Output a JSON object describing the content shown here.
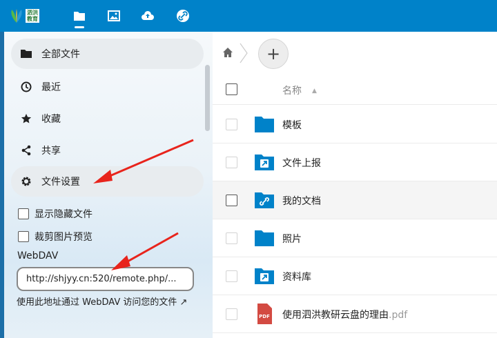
{
  "topbar": {
    "logo_text": "泗洪\n教育",
    "apps": [
      {
        "icon": "folder-icon",
        "active": true
      },
      {
        "icon": "image-icon",
        "active": false
      },
      {
        "icon": "cloud-upload-icon",
        "active": false
      },
      {
        "icon": "link-circle-icon",
        "active": false
      }
    ],
    "bg_color": "#0082c9"
  },
  "sidebar": {
    "items": [
      {
        "label": "全部文件",
        "icon": "folder-icon"
      },
      {
        "label": "最近",
        "icon": "clock-icon"
      },
      {
        "label": "收藏",
        "icon": "star-icon"
      },
      {
        "label": "共享",
        "icon": "share-icon"
      },
      {
        "label": "文件设置",
        "icon": "gear-icon"
      }
    ],
    "settings": {
      "show_hidden_label": "显示隐藏文件",
      "crop_preview_label": "裁剪图片预览",
      "webdav_label": "WebDAV",
      "webdav_url": "http://shjyy.cn:520/remote.php/...",
      "webdav_help": "使用此地址通过 WebDAV 访问您的文件 ↗"
    }
  },
  "main": {
    "add_button": "+",
    "header": {
      "name_label": "名称",
      "sort_indicator": "▲"
    },
    "files": [
      {
        "name": "模板",
        "ext": "",
        "icon": "folder-icon"
      },
      {
        "name": "文件上报",
        "ext": "",
        "icon": "shared-folder-icon"
      },
      {
        "name": "我的文档",
        "ext": "",
        "icon": "linked-folder-icon"
      },
      {
        "name": "照片",
        "ext": "",
        "icon": "folder-icon"
      },
      {
        "name": "资料库",
        "ext": "",
        "icon": "shared-folder-icon"
      },
      {
        "name": "使用泗洪教研云盘的理由",
        "ext": ".pdf",
        "icon": "pdf-file-icon"
      }
    ]
  },
  "colors": {
    "accent": "#0082c9",
    "folder": "#0082c9",
    "pdf": "#d34a42",
    "arrow": "#e8241c"
  }
}
